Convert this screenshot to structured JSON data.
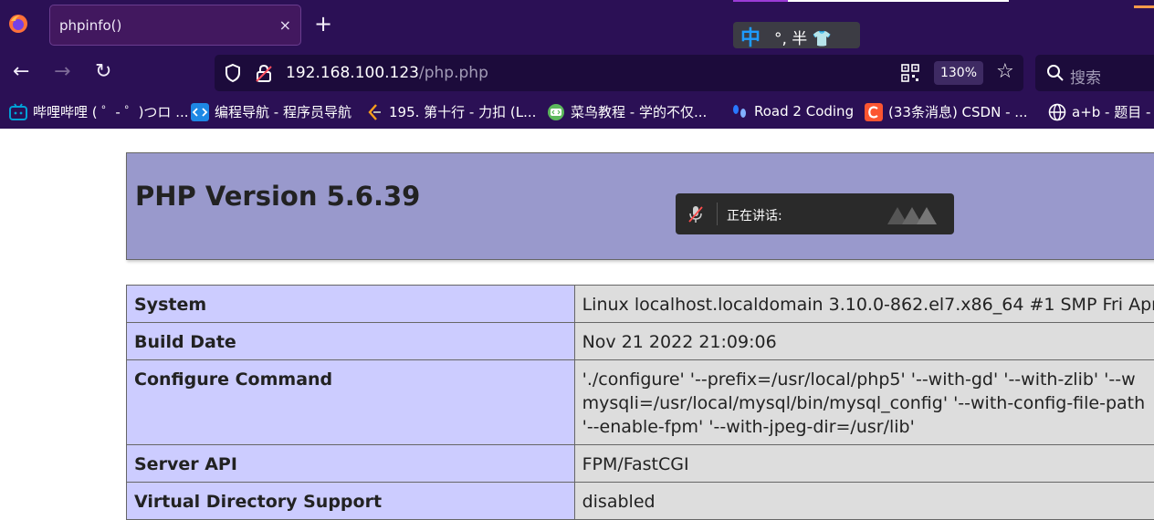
{
  "tab": {
    "title": "phpinfo()",
    "close": "×",
    "new_tab": "+"
  },
  "ime": {
    "lang": "中",
    "rest": "°, 半 👕"
  },
  "nav": {
    "back": "←",
    "forward": "→",
    "reload": "↻"
  },
  "address": {
    "host": "192.168.100.123",
    "path": "/php.php",
    "zoom": "130%",
    "star": "☆"
  },
  "search": {
    "placeholder": "搜索"
  },
  "bookmarks": [
    {
      "label": "哔哩哔哩 ( ゜- ゜)つロ ...",
      "icon": "bilibili-icon",
      "color": "#00a1d6"
    },
    {
      "label": "编程导航 - 程序员导航",
      "icon": "code-nav-icon",
      "color": "#1e88e5"
    },
    {
      "label": "195. 第十行 - 力扣 (L...",
      "icon": "leetcode-icon",
      "color": "#f89f1b"
    },
    {
      "label": "菜鸟教程 - 学的不仅...",
      "icon": "runoob-icon",
      "color": "#5cb85c"
    },
    {
      "label": "Road 2 Coding",
      "icon": "footprint-icon",
      "color": "#2979ff"
    },
    {
      "label": "(33条消息) CSDN - ...",
      "icon": "csdn-icon",
      "color": "#fc5531"
    },
    {
      "label": "a+b - 题目 -",
      "icon": "globe-icon",
      "color": "#ffffff"
    }
  ],
  "php": {
    "title": "PHP Version 5.6.39"
  },
  "voice_popup": {
    "label": "正在讲话:"
  },
  "info_rows": [
    {
      "key": "System",
      "lines": [
        "Linux localhost.localdomain 3.10.0-862.el7.x86_64 #1 SMP Fri Apr"
      ]
    },
    {
      "key": "Build Date",
      "lines": [
        "Nov 21 2022 21:09:06"
      ]
    },
    {
      "key": "Configure Command",
      "lines": [
        "'./configure' '--prefix=/usr/local/php5' '--with-gd' '--with-zlib' '--w",
        "mysqli=/usr/local/mysql/bin/mysql_config' '--with-config-file-path",
        "'--enable-fpm' '--with-jpeg-dir=/usr/lib'"
      ]
    },
    {
      "key": "Server API",
      "lines": [
        "FPM/FastCGI"
      ]
    },
    {
      "key": "Virtual Directory Support",
      "lines": [
        "disabled"
      ]
    }
  ]
}
